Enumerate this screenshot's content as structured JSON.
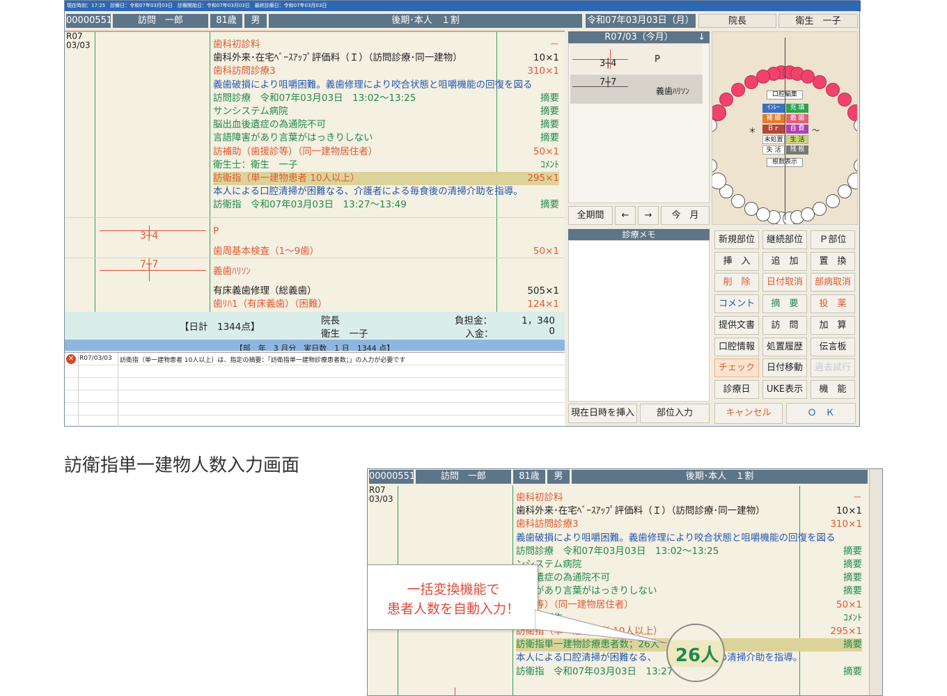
{
  "status_bar": "現在時刻：17:25　診療日：令和07年03月03日　診療開始日：令和07年03月03日　最終診療日：令和07年03月03日",
  "patient": {
    "id": "00000551",
    "name": "訪問　一郎",
    "age": "81歳",
    "sex": "男",
    "insurance": "後期･本人　１割",
    "date": "令和07年03月03日（月）",
    "doctor": "院長",
    "hygienist": "衛生　一子"
  },
  "record": {
    "date_year": "R07",
    "date_md": "03/03",
    "rows": [
      {
        "text": "歯科初診料",
        "right": "－",
        "cls": "c-red"
      },
      {
        "text": "歯科外来･在宅ﾍﾞｰｽｱｯﾌﾟ評価料（Ｉ）（訪問診療･同一建物）",
        "right": "10×1",
        "cls": "c-black"
      },
      {
        "text": "歯科訪問診療3",
        "right": "310×1",
        "cls": "c-red"
      },
      {
        "text": "義歯破損により咀嚼困難。義歯修理により咬合状態と咀嚼機能の回復を図る",
        "right": "",
        "cls": "c-blue"
      },
      {
        "text": "訪問診療　令和07年03月03日　13:02～13:25",
        "right": "摘要",
        "cls": "c-green"
      },
      {
        "text": "サンシステム病院",
        "right": "摘要",
        "cls": "c-green"
      },
      {
        "text": "脳出血後遺症の為通院不可",
        "right": "摘要",
        "cls": "c-green"
      },
      {
        "text": "言語障害があり言葉がはっきりしない",
        "right": "摘要",
        "cls": "c-green"
      },
      {
        "text": "訪補助（歯援診等）（同一建物居住者）",
        "right": "50×1",
        "cls": "c-red"
      },
      {
        "text": "衛生士：衛生　一子",
        "right": "ｺﾒﾝﾄ",
        "cls": "c-green"
      },
      {
        "text": "訪衛指（単一建物患者 10人以上）",
        "right": "295×1",
        "cls": "c-red"
      },
      {
        "text": "本人による口腔清掃が困難なる、介護者による毎食後の清掃介助を指導。",
        "right": "",
        "cls": "c-blue"
      },
      {
        "text": "訪衛指　令和07年03月03日　13:27～13:49",
        "right": "摘要",
        "cls": "c-green"
      }
    ],
    "tooth_a": "3┼4",
    "p_label": "P",
    "perio": "歯周基本検査（1～9歯）",
    "perio_val": "50×1",
    "tooth_b": "7┼7",
    "denture": "義歯ﾊﾘｿﾝ",
    "repair": "有床義歯修理（総義歯）",
    "repair_val": "505×1",
    "reline": "歯ﾘﾊ1（有床義歯）（困難）",
    "reline_val": "124×1"
  },
  "summary": {
    "daily": "【日計　1344点】",
    "doctor": "院長",
    "hygienist": "衛生　一子",
    "burden_label": "負担金：",
    "burden": "1，340",
    "paid_label": "入金：",
    "paid": "0",
    "month": "【部　年　3 月分　実日数　1 日　1344 点】"
  },
  "error": {
    "date": "R07/03/03",
    "msg": "訪衛指（単一建物患者 10人以上）は、指定の摘要：「訪衛指単一建物診療患者数；」の入力が必要です"
  },
  "mid": {
    "month": "R07/03（今月）",
    "r1a": "3┼4",
    "r1b": "P",
    "r2a": "7┼7",
    "r2b": "義歯ﾊﾘｿﾝ",
    "all": "全期間",
    "prev": "←",
    "next": "→",
    "today": "今　月",
    "memo": "診療メモ",
    "now": "現在日時を挿入",
    "part": "部位入力"
  },
  "chart": {
    "edit": "口腔編集",
    "root": "根数表示",
    "star": "＊",
    "tilde": "～",
    "chips": [
      [
        "ｲﾝﾚｰ",
        "#3d6fc4"
      ],
      [
        "充 填",
        "#2ea24f"
      ],
      [
        "補 綴",
        "#e07d2f"
      ],
      [
        "義 歯",
        "#e0607a"
      ],
      [
        "Ｂｒ",
        "#b5473a"
      ],
      [
        "自 費",
        "#b040b0"
      ],
      [
        "未処置",
        "#ffffff"
      ],
      [
        "生 活",
        "#c9d77a"
      ],
      [
        "失 活",
        "#ffffff"
      ],
      [
        "残 根",
        "#777777"
      ]
    ]
  },
  "buttons": [
    [
      "新規部位",
      "継続部位",
      "Ｐ部位"
    ],
    [
      "挿　入",
      "追　加",
      "置　換"
    ],
    [
      "削　除",
      "日付取消",
      "部病取消"
    ],
    [
      "コメント",
      "摘　要",
      "投　薬"
    ],
    [
      "提供文書",
      "訪　問",
      "加　算"
    ],
    [
      "口腔情報",
      "処置履歴",
      "伝言板"
    ],
    [
      "チェック",
      "日付移動",
      "過去試行"
    ],
    [
      "診療日",
      "UKE表示",
      "機　能"
    ]
  ],
  "cancel": "キャンセル",
  "ok": "Ｏ　Ｋ",
  "caption": "訪衛指単一建物人数入力画面",
  "zoom": {
    "rows": [
      {
        "text": "歯科初診料",
        "right": "－",
        "cls": "c-red"
      },
      {
        "text": "歯科外来･在宅ﾍﾞｰｽｱｯﾌﾟ評価料（Ｉ）（訪問診療･同一建物）",
        "right": "10×1",
        "cls": "c-black"
      },
      {
        "text": "歯科訪問診療3",
        "right": "310×1",
        "cls": "c-red"
      },
      {
        "text": "義歯破損により咀嚼困難。義歯修理により咬合状態と咀嚼機能の回復を図る",
        "right": "",
        "cls": "c-blue"
      },
      {
        "text": "訪問診療　令和07年03月03日　13:02～13:25",
        "right": "摘要",
        "cls": "c-green"
      },
      {
        "text": "ンシステム病院",
        "right": "摘要",
        "cls": "c-green"
      },
      {
        "text": "血後遺症の為通院不可",
        "right": "摘要",
        "cls": "c-green"
      },
      {
        "text": "障害があり言葉がはっきりしない",
        "right": "摘要",
        "cls": "c-green"
      },
      {
        "text": "援診等）（同一建物居住者）",
        "right": "50×1",
        "cls": "c-red"
      },
      {
        "text": "生士：衛生",
        "right": "ｺﾒﾝﾄ",
        "cls": "c-green"
      },
      {
        "text": "訪衛指（単一建物患者 10人以上）",
        "right": "295×1",
        "cls": "c-red"
      },
      {
        "text": "訪衛指単一建物診療患者数；26人",
        "right": "摘要",
        "cls": "c-green"
      },
      {
        "text": "本人による口腔清掃が困難なる、　　　る毎食後の清掃介助を指導。",
        "right": "",
        "cls": "c-blue"
      },
      {
        "text": "訪衛指　令和07年03月03日　13:27～13",
        "right": "摘要",
        "cls": "c-green"
      }
    ],
    "callout_l1": "一括変換機能で",
    "callout_l2": "患者人数を自動入力！",
    "magnifier": "26人"
  }
}
